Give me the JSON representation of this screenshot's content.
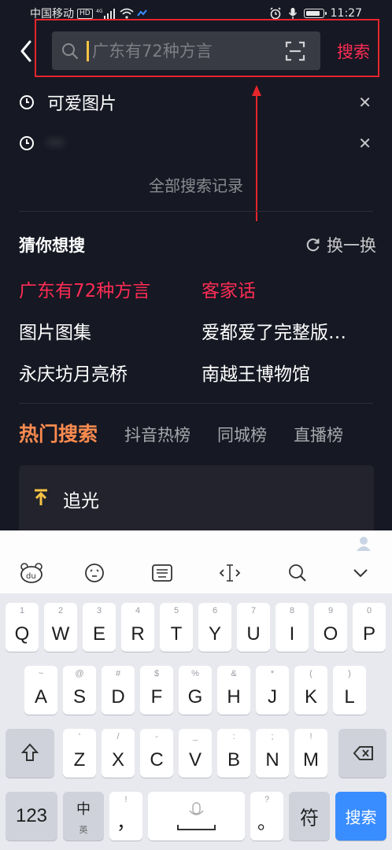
{
  "status_bar": {
    "carrier": "中国移动",
    "hd_label": "HD",
    "network": "4G",
    "time": "11:27",
    "battery_level": 0.85
  },
  "header": {
    "search_value": "",
    "search_placeholder": "广东有72种方言",
    "search_button": "搜索"
  },
  "history": {
    "items": [
      {
        "text": "可爱图片",
        "blurred": false
      },
      {
        "text": "···",
        "blurred": true
      }
    ],
    "all_label": "全部搜索记录"
  },
  "guess": {
    "title": "猜你想搜",
    "refresh_label": "换一换",
    "items": [
      {
        "text": "广东有72种方言",
        "hot": true
      },
      {
        "text": "客家话",
        "hot": true
      },
      {
        "text": "图片图集",
        "hot": false
      },
      {
        "text": "爱都爱了完整版…",
        "hot": false
      },
      {
        "text": "永庆坊月亮桥",
        "hot": false
      },
      {
        "text": "南越王博物馆",
        "hot": false
      }
    ]
  },
  "tabs": [
    "热门搜索",
    "抖音热榜",
    "同城榜",
    "直播榜"
  ],
  "hot_list": [
    {
      "text": "追光"
    }
  ],
  "colors": {
    "bg": "#161823",
    "accent": "#fe2c55",
    "tab_active": "#fa8b4f",
    "highlight_box": "#e6262b",
    "key_blue": "#3a8dfe"
  },
  "keyboard": {
    "row1": [
      {
        "main": "Q",
        "sub": "1"
      },
      {
        "main": "W",
        "sub": "2"
      },
      {
        "main": "E",
        "sub": "3"
      },
      {
        "main": "R",
        "sub": "4"
      },
      {
        "main": "T",
        "sub": "5"
      },
      {
        "main": "Y",
        "sub": "6"
      },
      {
        "main": "U",
        "sub": "7"
      },
      {
        "main": "I",
        "sub": "8"
      },
      {
        "main": "O",
        "sub": "9"
      },
      {
        "main": "P",
        "sub": "0"
      }
    ],
    "row2": [
      {
        "main": "A",
        "sub": "~"
      },
      {
        "main": "S",
        "sub": "@"
      },
      {
        "main": "D",
        "sub": "#"
      },
      {
        "main": "F",
        "sub": "$"
      },
      {
        "main": "G",
        "sub": "%"
      },
      {
        "main": "H",
        "sub": "&"
      },
      {
        "main": "J",
        "sub": "*"
      },
      {
        "main": "K",
        "sub": "("
      },
      {
        "main": "L",
        "sub": ")"
      }
    ],
    "row3": [
      {
        "main": "Z",
        "sub": "'"
      },
      {
        "main": "X",
        "sub": "/"
      },
      {
        "main": "C",
        "sub": "-"
      },
      {
        "main": "V",
        "sub": "_"
      },
      {
        "main": "B",
        "sub": ":"
      },
      {
        "main": "N",
        "sub": ";"
      },
      {
        "main": "M",
        "sub": "!"
      }
    ],
    "row4": {
      "num": "123",
      "zh": "中",
      "zh_sub": "英",
      "comma": "，",
      "comma_sub": "!",
      "period": "。",
      "period_sub": "?",
      "symbols": "符",
      "search": "搜索"
    }
  }
}
